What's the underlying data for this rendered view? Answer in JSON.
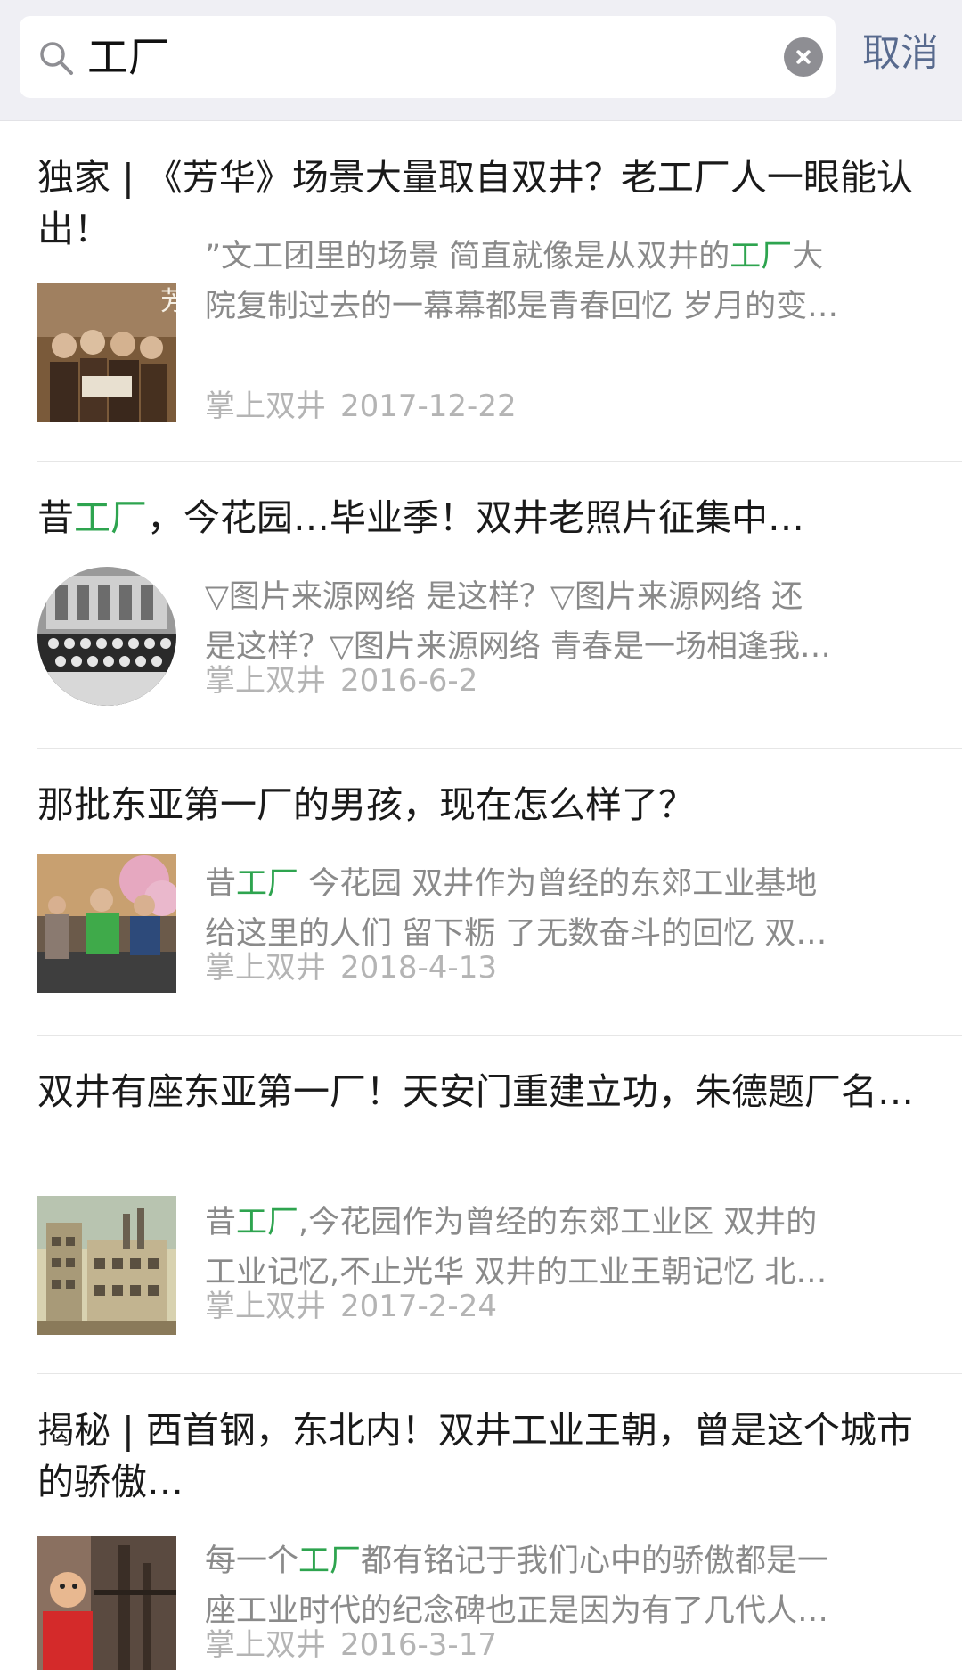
{
  "search": {
    "query": "工厂",
    "cancel_label": "取消"
  },
  "results": [
    {
      "title": "独家 | 《芳华》场景大量取自双井？老工厂人一眼能认出！",
      "snippet_line1_a": "”文工团里的场景 简直就像是从双井的",
      "snippet_line1_hl": "工厂",
      "snippet_line1_b": "大",
      "snippet_line2": "院复制过去的一幕幕都是青春回忆 岁月的变…",
      "source": "掌上双井",
      "date": "2017-12-22"
    },
    {
      "title_a": "昔",
      "title_hl": "工厂",
      "title_b": "，今花园…毕业季！双井老照片征集中…",
      "snippet_line1": "▽图片来源网络 是这样？▽图片来源网络 还",
      "snippet_line2": "是这样？▽图片来源网络 青春是一场相逢我…",
      "source": "掌上双井",
      "date": "2016-6-2"
    },
    {
      "title": "那批东亚第一厂的男孩，现在怎么样了？",
      "snippet_line1_a": "昔",
      "snippet_line1_hl": "工厂",
      "snippet_line1_b": " 今花园 双井作为曾经的东郊工业基地",
      "snippet_line2": "给这里的人们 留下粝 了无数奋斗的回忆 双…",
      "source": "掌上双井",
      "date": "2018-4-13"
    },
    {
      "title": "双井有座东亚第一厂！天安门重建立功，朱德题厂名…",
      "snippet_line1_a": "昔",
      "snippet_line1_hl": "工厂",
      "snippet_line1_b": ",今花园作为曾经的东郊工业区 双井的",
      "snippet_line2": "工业记忆,不止光华 双井的工业王朝记忆 北…",
      "source": "掌上双井",
      "date": "2017-2-24"
    },
    {
      "title": "揭秘 | 西首钢，东北内！双井工业王朝，曾是这个城市的骄傲…",
      "snippet_line1_a": "每一个",
      "snippet_line1_hl": "工厂",
      "snippet_line1_b": "都有铭记于我们心中的骄傲都是一",
      "snippet_line2": "座工业时代的纪念碑也正是因为有了几代人…",
      "source": "掌上双井",
      "date": "2016-3-17"
    }
  ],
  "colors": {
    "highlight": "#2ea44f",
    "cancel": "#586a8e",
    "topbar_bg": "#efeff4"
  },
  "icons": {
    "search": "magnifier-icon",
    "clear": "clear-circle-x-icon"
  }
}
